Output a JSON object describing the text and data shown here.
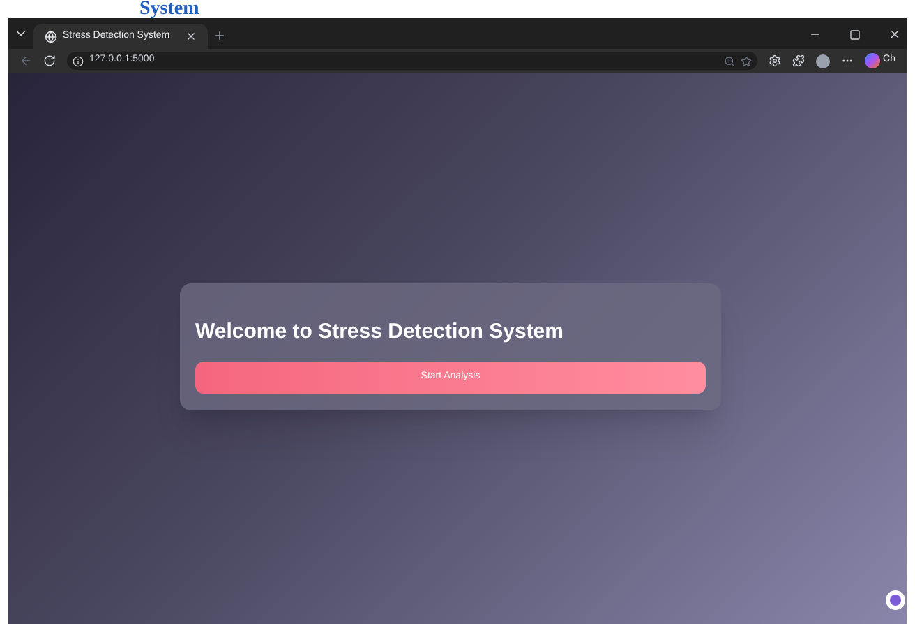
{
  "document_heading": "System",
  "browser": {
    "tab": {
      "title": "Stress Detection System",
      "selected": true
    },
    "address": "127.0.0.1:5000",
    "profile_label": "Ch"
  },
  "page": {
    "title": "Welcome to Stress Detection System",
    "button": "Start Analysis"
  }
}
